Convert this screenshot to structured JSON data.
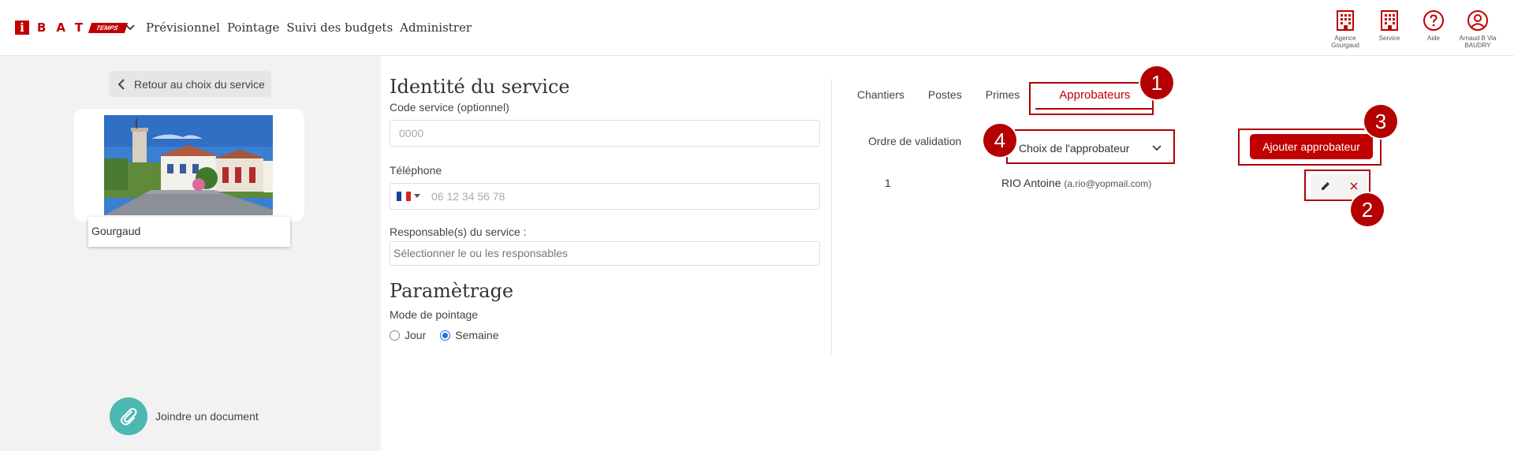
{
  "brand": {
    "letters": "BAT",
    "logo_i": "i",
    "temps": "TEMPS"
  },
  "nav": {
    "items": [
      "Prévisionnel",
      "Pointage",
      "Suivi des budgets",
      "Administrer"
    ]
  },
  "top_actions": [
    {
      "icon": "building-icon",
      "label": "Agence Gourgaud"
    },
    {
      "icon": "building-icon",
      "label": "Service"
    },
    {
      "icon": "help-icon",
      "label": "Aide"
    },
    {
      "icon": "user-icon",
      "label": "Arnaud B Via BAUDRY"
    }
  ],
  "left": {
    "back_label": "Retour au choix du service",
    "service_name": "Gourgaud",
    "attach_label": "Joindre un document"
  },
  "form": {
    "identity_title": "Identité du service",
    "code_label": "Code service (optionnel)",
    "code_placeholder": "0000",
    "phone_label": "Téléphone",
    "phone_placeholder": "06 12 34 56 78",
    "resp_label": "Responsable(s) du service :",
    "resp_placeholder": "Sélectionner le ou les responsables",
    "params_title": "Paramètrage",
    "mode_label": "Mode de pointage",
    "mode_options": [
      "Jour",
      "Semaine"
    ],
    "mode_selected": "Semaine"
  },
  "tabs": [
    "Chantiers",
    "Postes",
    "Primes",
    "Approbateurs"
  ],
  "active_tab": "Approbateurs",
  "approvers": {
    "order_label": "Ordre de validation",
    "select_placeholder": "Choix de l'approbateur",
    "add_button": "Ajouter approbateur",
    "rows": [
      {
        "order": "1",
        "name": "RIO Antoine",
        "email": "(a.rio@yopmail.com)"
      }
    ]
  },
  "badges": [
    "1",
    "2",
    "3",
    "4"
  ],
  "colors": {
    "accent": "#c00000",
    "attach": "#4db8b2",
    "radio": "#1a73e8"
  }
}
